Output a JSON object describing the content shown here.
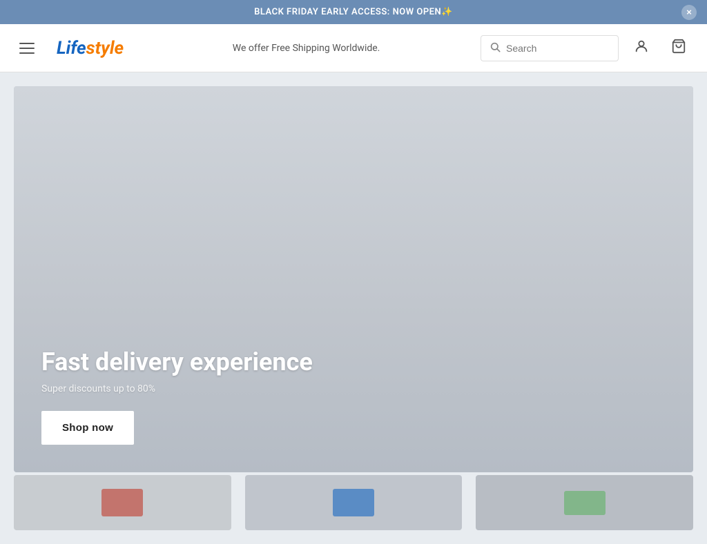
{
  "announcement": {
    "text": "BLACK FRIDAY EARLY ACCESS: NOW OPEN✨",
    "close_label": "×"
  },
  "header": {
    "hamburger_label": "menu",
    "logo_text": "Lifestyle",
    "shipping_text": "We offer Free Shipping Worldwide.",
    "search_placeholder": "Search",
    "user_icon": "👤",
    "cart_icon": "🛒"
  },
  "hero": {
    "title": "Fast delivery experience",
    "subtitle": "Super discounts up to 80%",
    "cta_label": "Shop now",
    "bg_color": "#c8cdd4"
  },
  "products": [
    {
      "label": "product-1",
      "color": "#c8cdd4"
    },
    {
      "label": "product-2",
      "color": "#c0c5cc"
    },
    {
      "label": "product-3",
      "color": "#b8bdc4"
    }
  ]
}
